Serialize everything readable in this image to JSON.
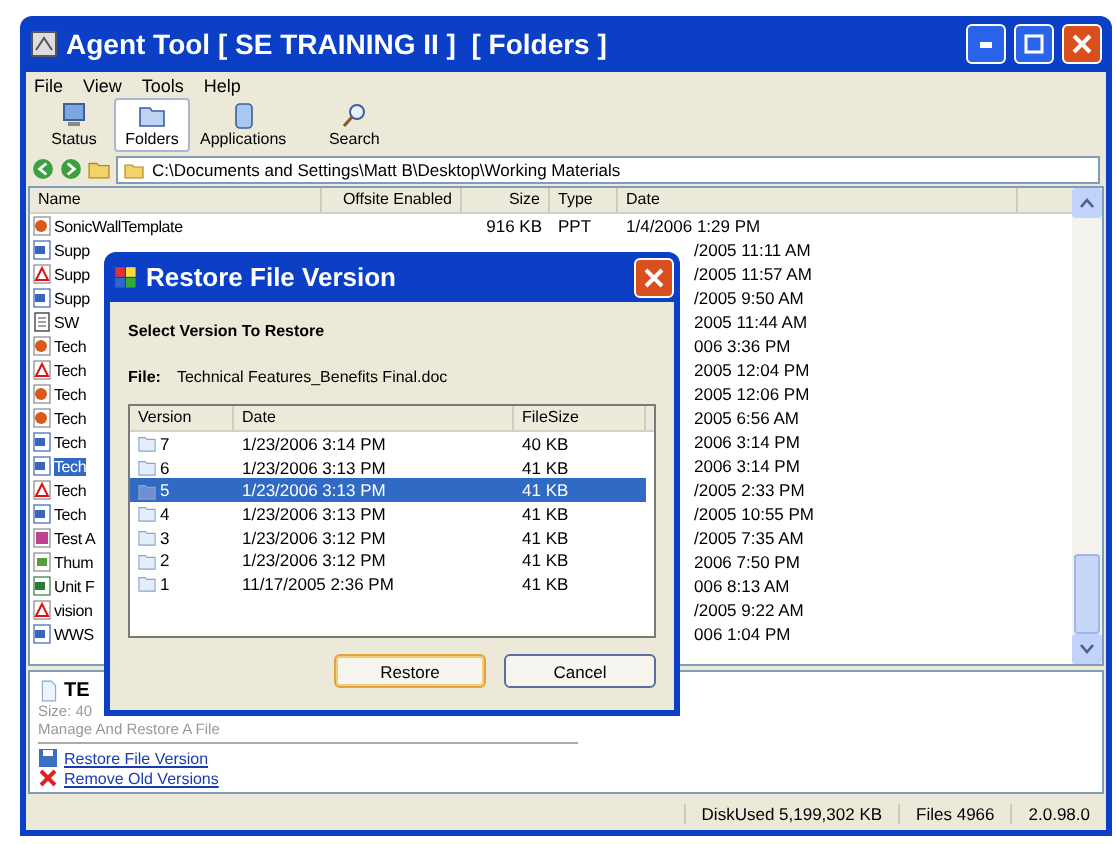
{
  "window": {
    "title": "Agent Tool [ SE TRAINING II ]  [ Folders ]"
  },
  "menu": [
    "File",
    "View",
    "Tools",
    "Help"
  ],
  "toolbar": [
    {
      "label": "Status",
      "kind": "status",
      "selected": false
    },
    {
      "label": "Folders",
      "kind": "folders",
      "selected": true
    },
    {
      "label": "Applications",
      "kind": "applications",
      "selected": false
    },
    {
      "label": "Search",
      "kind": "search",
      "selected": false
    }
  ],
  "address": {
    "value": "C:\\Documents and Settings\\Matt B\\Desktop\\Working Materials"
  },
  "file_list": {
    "columns": [
      "Name",
      "Offsite Enabled",
      "Size",
      "Type",
      "Date"
    ],
    "rows": [
      {
        "name": "SonicWallTemplate",
        "size": "916 KB",
        "type": "PPT",
        "date": "1/4/2006 1:29 PM",
        "kind": "ppt",
        "selected": false
      },
      {
        "name": "Supp",
        "date": "/2005 11:11 AM",
        "kind": "doc",
        "selected": false
      },
      {
        "name": "Supp",
        "date": "/2005 11:57 AM",
        "kind": "pdf",
        "selected": false
      },
      {
        "name": "Supp",
        "date": "/2005 9:50 AM",
        "kind": "doc",
        "selected": false
      },
      {
        "name": "SW",
        "date": "2005 11:44 AM",
        "kind": "txt",
        "selected": false
      },
      {
        "name": "Tech",
        "date": "006 3:36 PM",
        "kind": "ppt",
        "selected": false
      },
      {
        "name": "Tech",
        "date": "2005 12:04 PM",
        "kind": "pdf",
        "selected": false
      },
      {
        "name": "Tech",
        "date": "2005 12:06 PM",
        "kind": "ppt",
        "selected": false
      },
      {
        "name": "Tech",
        "date": "2005 6:56 AM",
        "kind": "ppt",
        "selected": false
      },
      {
        "name": "Tech",
        "date": "2006 3:14 PM",
        "kind": "doc",
        "selected": false
      },
      {
        "name": "Tech",
        "date": "2006 3:14 PM",
        "kind": "doc",
        "selected": true
      },
      {
        "name": "Tech",
        "date": "/2005 2:33 PM",
        "kind": "pdf",
        "selected": false
      },
      {
        "name": "Tech",
        "date": "/2005 10:55 PM",
        "kind": "doc",
        "selected": false
      },
      {
        "name": "Test A",
        "date": "/2005 7:35 AM",
        "kind": "img",
        "selected": false
      },
      {
        "name": "Thum",
        "date": "2006 7:50 PM",
        "kind": "db",
        "selected": false
      },
      {
        "name": "Unit F",
        "date": "006 8:13 AM",
        "kind": "xls",
        "selected": false
      },
      {
        "name": "vision",
        "date": "/2005 9:22 AM",
        "kind": "pdf",
        "selected": false
      },
      {
        "name": "WWS",
        "date": "006 1:04 PM",
        "kind": "doc",
        "selected": false
      }
    ]
  },
  "details": {
    "title": "TE",
    "size": "Size: 40",
    "description": "Manage And Restore A File",
    "links": [
      {
        "label": "Restore File Version",
        "kind": "restore"
      },
      {
        "label": "Remove Old Versions",
        "kind": "remove"
      }
    ]
  },
  "status_bar": [
    "DiskUsed 5,199,302 KB",
    "Files 4966",
    "2.0.98.0"
  ],
  "dialog": {
    "title": "Restore File Version",
    "heading": "Select Version To Restore",
    "file_label": "File:",
    "file_name": "Technical Features_Benefits Final.doc",
    "columns": [
      "Version",
      "Date",
      "FileSize"
    ],
    "rows": [
      {
        "version": "7",
        "date": "1/23/2006 3:14 PM",
        "size": "40 KB",
        "selected": false
      },
      {
        "version": "6",
        "date": "1/23/2006 3:13 PM",
        "size": "41 KB",
        "selected": false
      },
      {
        "version": "5",
        "date": "1/23/2006 3:13 PM",
        "size": "41 KB",
        "selected": true
      },
      {
        "version": "4",
        "date": "1/23/2006 3:13 PM",
        "size": "41 KB",
        "selected": false
      },
      {
        "version": "3",
        "date": "1/23/2006 3:12 PM",
        "size": "41 KB",
        "selected": false
      },
      {
        "version": "2",
        "date": "1/23/2006 3:12 PM",
        "size": "41 KB",
        "selected": false
      },
      {
        "version": "1",
        "date": "11/17/2005 2:36 PM",
        "size": "41 KB",
        "selected": false
      }
    ],
    "buttons": [
      {
        "label": "Restore",
        "kind": "default"
      },
      {
        "label": "Cancel",
        "kind": "normal"
      }
    ]
  }
}
